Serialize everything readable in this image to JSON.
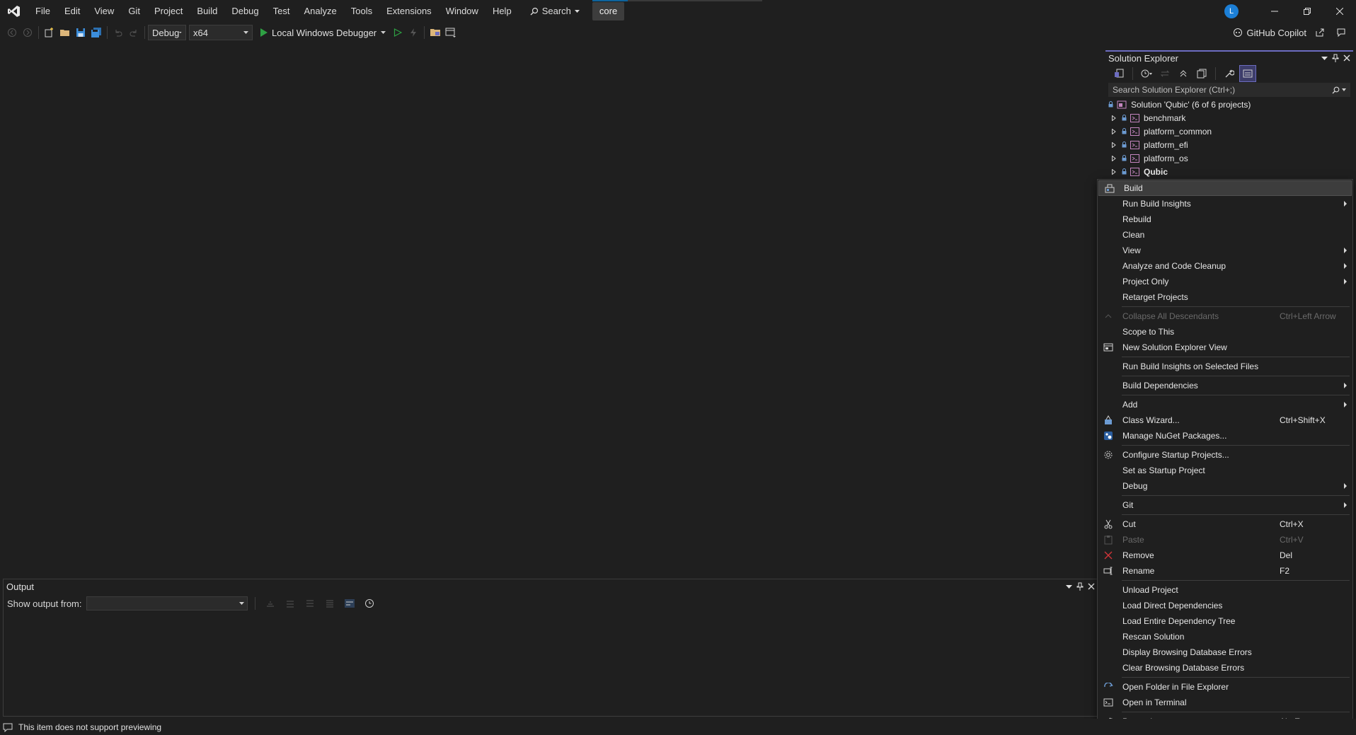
{
  "app": {
    "menu": [
      "File",
      "Edit",
      "View",
      "Git",
      "Project",
      "Build",
      "Debug",
      "Test",
      "Analyze",
      "Tools",
      "Extensions",
      "Window",
      "Help"
    ],
    "search_label": "Search",
    "solution_badge": "core",
    "avatar_initial": "L",
    "progress_fraction": 0.21
  },
  "toolbar": {
    "configuration": "Debug",
    "platform": "x64",
    "run_target": "Local Windows Debugger",
    "copilot_label": "GitHub Copilot"
  },
  "solution_explorer": {
    "title": "Solution Explorer",
    "search_placeholder": "Search Solution Explorer (Ctrl+;)",
    "solution_label": "Solution 'Qubic' (6 of 6 projects)",
    "projects": [
      "benchmark",
      "platform_common",
      "platform_efi",
      "platform_os",
      "Qubic"
    ]
  },
  "context_menu": {
    "items": [
      {
        "label": "Build",
        "icon": "build-icon",
        "highlight": true
      },
      {
        "label": "Run Build Insights",
        "submenu": true
      },
      {
        "label": "Rebuild"
      },
      {
        "label": "Clean"
      },
      {
        "label": "View",
        "submenu": true
      },
      {
        "label": "Analyze and Code Cleanup",
        "submenu": true
      },
      {
        "label": "Project Only",
        "submenu": true
      },
      {
        "label": "Retarget Projects"
      },
      {
        "sep": true
      },
      {
        "label": "Collapse All Descendants",
        "shortcut": "Ctrl+Left Arrow",
        "disabled": true,
        "icon": "collapse-icon"
      },
      {
        "label": "Scope to This"
      },
      {
        "label": "New Solution Explorer View",
        "icon": "new-view-icon"
      },
      {
        "sep": true
      },
      {
        "label": "Run Build Insights on Selected Files"
      },
      {
        "sep": true
      },
      {
        "label": "Build Dependencies",
        "submenu": true
      },
      {
        "sep": true
      },
      {
        "label": "Add",
        "submenu": true
      },
      {
        "label": "Class Wizard...",
        "shortcut": "Ctrl+Shift+X",
        "icon": "class-wizard-icon"
      },
      {
        "label": "Manage NuGet Packages...",
        "icon": "nuget-icon"
      },
      {
        "sep": true
      },
      {
        "label": "Configure Startup Projects...",
        "icon": "gear-icon"
      },
      {
        "label": "Set as Startup Project"
      },
      {
        "label": "Debug",
        "submenu": true
      },
      {
        "sep": true
      },
      {
        "label": "Git",
        "submenu": true
      },
      {
        "sep": true
      },
      {
        "label": "Cut",
        "shortcut": "Ctrl+X",
        "icon": "scissors-icon"
      },
      {
        "label": "Paste",
        "shortcut": "Ctrl+V",
        "disabled": true,
        "icon": "paste-icon"
      },
      {
        "label": "Remove",
        "shortcut": "Del",
        "icon": "remove-icon"
      },
      {
        "label": "Rename",
        "shortcut": "F2",
        "icon": "rename-icon"
      },
      {
        "sep": true
      },
      {
        "label": "Unload Project"
      },
      {
        "label": "Load Direct Dependencies"
      },
      {
        "label": "Load Entire Dependency Tree"
      },
      {
        "label": "Rescan Solution"
      },
      {
        "label": "Display Browsing Database Errors"
      },
      {
        "label": "Clear Browsing Database Errors"
      },
      {
        "sep": true
      },
      {
        "label": "Open Folder in File Explorer",
        "icon": "open-folder-icon"
      },
      {
        "label": "Open in Terminal",
        "icon": "terminal-icon"
      },
      {
        "sep": true
      },
      {
        "label": "Properties",
        "shortcut": "Alt+Enter",
        "icon": "wrench-icon"
      }
    ]
  },
  "output": {
    "title": "Output",
    "show_output_label": "Show output from:",
    "show_output_value": ""
  },
  "status": {
    "message": "This item does not support previewing"
  },
  "colors": {
    "background": "#1f1f1f",
    "accent": "#6c6cc0",
    "run_green": "#2ea043",
    "remove_red": "#d13438"
  }
}
